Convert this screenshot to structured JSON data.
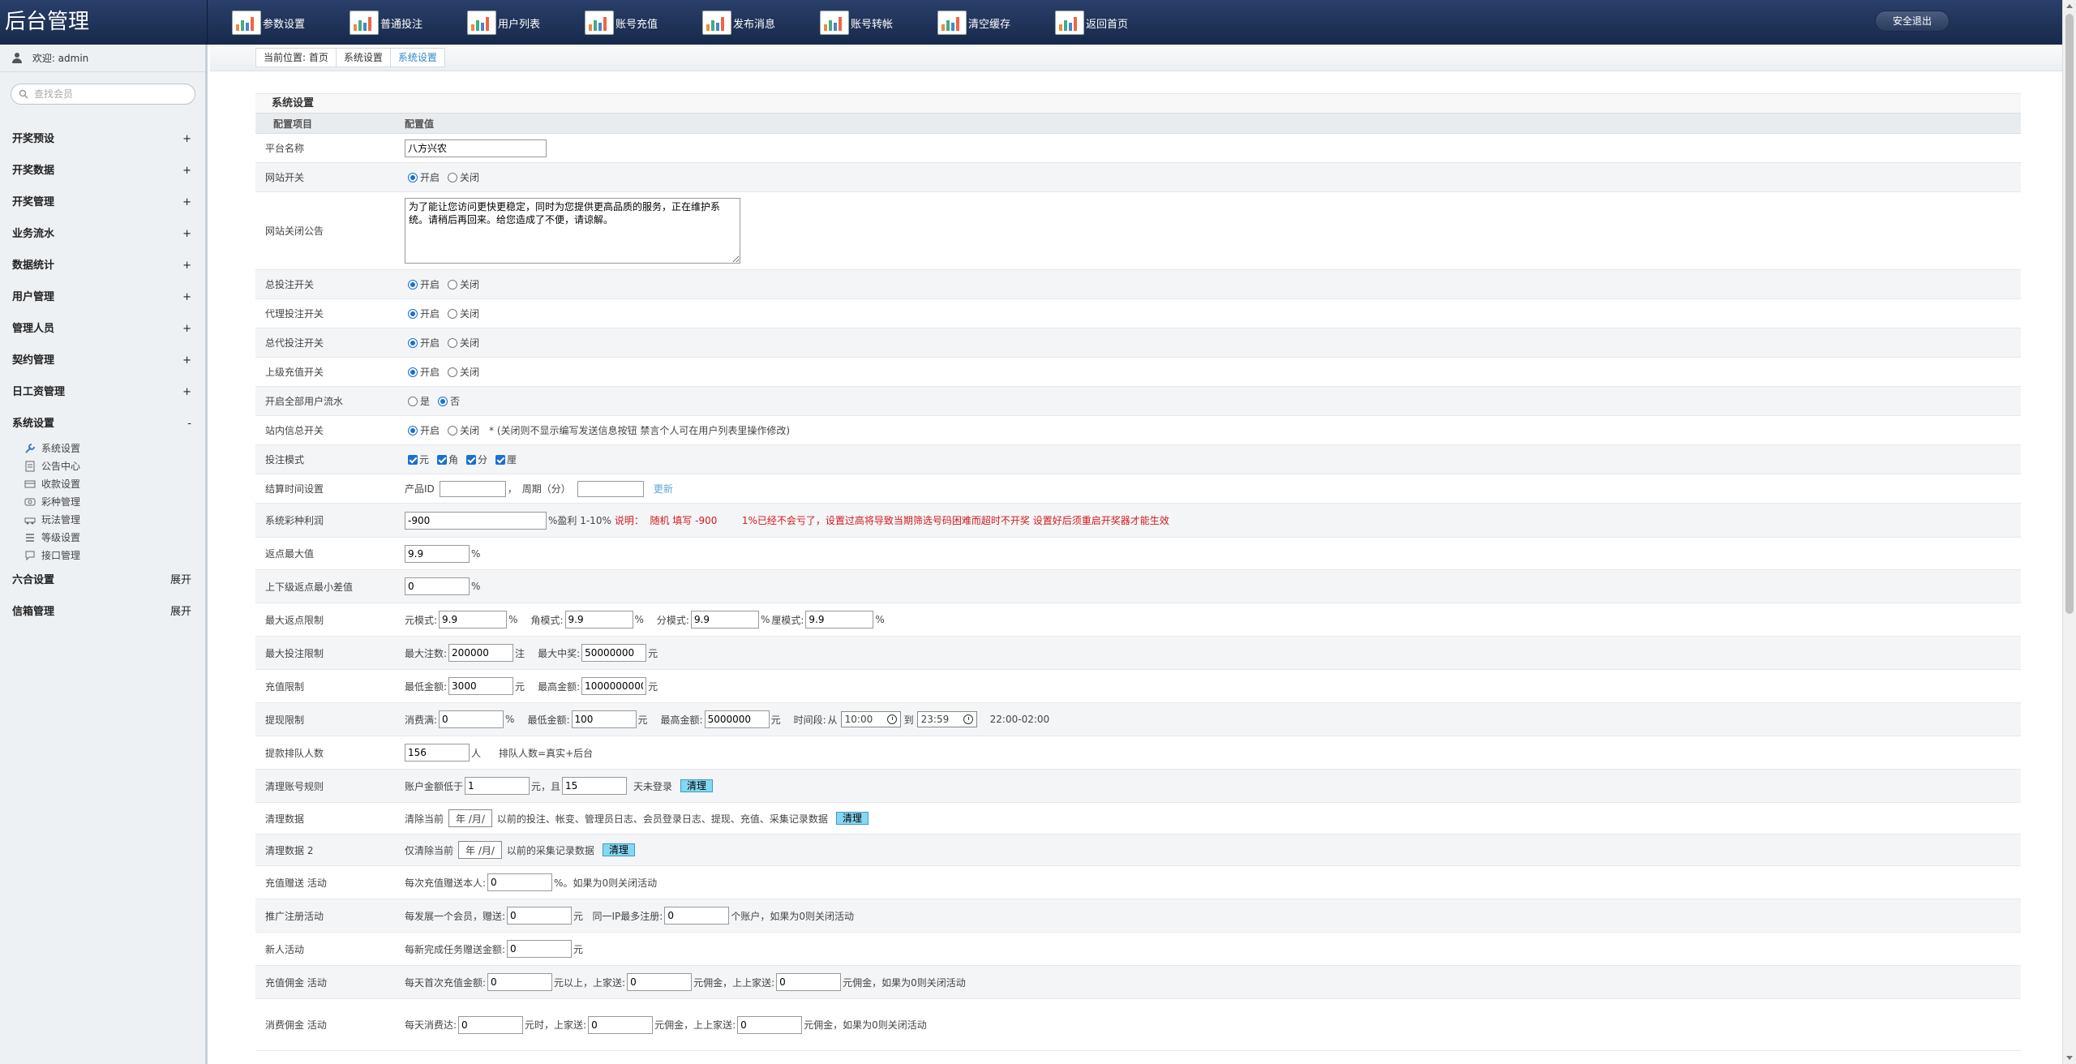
{
  "header": {
    "brand": "后台管理",
    "nav": [
      "参数设置",
      "普通投注",
      "用户列表",
      "账号充值",
      "发布消息",
      "账号转帐",
      "清空缓存",
      "返回首页"
    ],
    "logout": "安全退出"
  },
  "sidebar": {
    "welcome": "欢迎: admin",
    "search_placeholder": "查找会员",
    "menus": [
      {
        "label": "开奖预设",
        "toggle": "+"
      },
      {
        "label": "开奖数据",
        "toggle": "+"
      },
      {
        "label": "开奖管理",
        "toggle": "+"
      },
      {
        "label": "业务流水",
        "toggle": "+"
      },
      {
        "label": "数据统计",
        "toggle": "+"
      },
      {
        "label": "用户管理",
        "toggle": "+"
      },
      {
        "label": "管理人员",
        "toggle": "+"
      },
      {
        "label": "契约管理",
        "toggle": "+"
      },
      {
        "label": "日工资管理",
        "toggle": "+"
      },
      {
        "label": "系统设置",
        "toggle": "-"
      }
    ],
    "submenus": [
      {
        "label": "系统设置",
        "icon": "wrench-icon"
      },
      {
        "label": "公告中心",
        "icon": "document-icon"
      },
      {
        "label": "收款设置",
        "icon": "bank-card-icon"
      },
      {
        "label": "彩种管理",
        "icon": "ticket-icon"
      },
      {
        "label": "玩法管理",
        "icon": "car-icon"
      },
      {
        "label": "等级设置",
        "icon": "list-icon"
      },
      {
        "label": "接口管理",
        "icon": "chat-icon"
      }
    ],
    "bottom_menus": [
      {
        "label": "六合设置",
        "toggle": "展开"
      },
      {
        "label": "信箱管理",
        "toggle": "展开"
      }
    ]
  },
  "breadcrumb": [
    "当前位置: 首页",
    "系统设置",
    "系统设置"
  ],
  "panel": {
    "title": "系统设置",
    "col_key": "配置项目",
    "col_val": "配置值"
  },
  "rows": {
    "platform_name": {
      "label": "平台名称",
      "value": "八方兴农"
    },
    "site_switch": {
      "label": "网站开关",
      "on": "开启",
      "off": "关闭"
    },
    "close_notice": {
      "label": "网站关闭公告",
      "value": "为了能让您访问更快更稳定，同时为您提供更高品质的服务，正在维护系统。请稍后再回来。给您造成了不便，请谅解。"
    },
    "bet_switch": {
      "label": "总投注开关",
      "on": "开启",
      "off": "关闭"
    },
    "agent_bet": {
      "label": "代理投注开关",
      "on": "开启",
      "off": "关闭"
    },
    "general_agent_bet": {
      "label": "总代投注开关",
      "on": "开启",
      "off": "关闭"
    },
    "upper_recharge": {
      "label": "上级充值开关",
      "on": "开启",
      "off": "关闭"
    },
    "all_user_flow": {
      "label": "开启全部用户流水",
      "yes": "是",
      "no": "否"
    },
    "inbox_switch": {
      "label": "站内信总开关",
      "on": "开启",
      "off": "关闭",
      "note": "* (关闭则不显示编写发送信息按钮 禁言个人可在用户列表里操作修改)"
    },
    "bet_mode": {
      "label": "投注模式",
      "options": [
        "元",
        "角",
        "分",
        "厘"
      ]
    },
    "settle_time": {
      "label": "结算时间设置",
      "pid": "产品ID",
      "period": "周期（分）",
      "update": "更新"
    },
    "lottery_profit": {
      "label": "系统彩种利润",
      "value": "-900",
      "suffix": "%盈利 1-10%",
      "note": "说明：  随机 填写 -900        1%已经不会亏了，设置过高将导致当期筛选号码困难而超时不开奖 设置好后须重启开奖器才能生效"
    },
    "max_rebate": {
      "label": "返点最大值",
      "value": "9.9",
      "unit": "%"
    },
    "rebate_diff": {
      "label": "上下级返点最小差值",
      "value": "0",
      "unit": "%"
    },
    "max_rebate_limit": {
      "label": "最大返点限制",
      "yuan": "元模式:",
      "jiao": "角模式:",
      "fen": "分模式:",
      "li": "厘模式:",
      "v1": "9.9",
      "v2": "9.9",
      "v3": "9.9",
      "v4": "9.9",
      "unit": "%"
    },
    "max_bet_limit": {
      "label": "最大投注限制",
      "max_count": "最大注数:",
      "count": "200000",
      "zhu": "注",
      "max_win": "最大中奖:",
      "win": "50000000",
      "yuan": "元"
    },
    "recharge_limit": {
      "label": "充值限制",
      "min": "最低金额:",
      "min_v": "3000",
      "max": "最高金额:",
      "max_v": "1000000000",
      "yuan": "元"
    },
    "withdraw_limit": {
      "label": "提现限制",
      "consume": "消费满:",
      "consume_v": "0",
      "pct": "%",
      "min": "最低金额:",
      "min_v": "100",
      "yuan1": "元",
      "max": "最高金额:",
      "max_v": "5000000",
      "yuan2": "元",
      "period": "时间段:",
      "from": "从",
      "from_v": "10:00",
      "to": "到",
      "to_v": "23:59",
      "range": "22:00-02:00"
    },
    "queue": {
      "label": "提款排队人数",
      "value": "156",
      "unit": "人",
      "note": "排队人数=真实+后台"
    },
    "clean_account": {
      "label": "清理账号规则",
      "pre": "账户金额低于",
      "v1": "1",
      "mid": "元，且",
      "v2": "15",
      "post": "天未登录",
      "btn": "清理"
    },
    "clean_data": {
      "label": "清理数据",
      "pre": "清除当前",
      "date": "年 /月/",
      "post": "以前的投注、帐变、管理员日志、会员登录日志、提现、充值、采集记录数据",
      "btn": "清理"
    },
    "clean_data2": {
      "label": "清理数据 2",
      "pre": "仅清除当前",
      "date": "年 /月/",
      "post": "以前的采集记录数据",
      "btn": "清理"
    },
    "recharge_gift": {
      "label": "充值赠送 活动",
      "pre": "每次充值赠送本人:",
      "value": "0",
      "post": "%。如果为0则关闭活动"
    },
    "promo_register": {
      "label": "推广注册活动",
      "pre": "每发展一个会员，赠送:",
      "v1": "0",
      "mid": "元   同一IP最多注册:",
      "v2": "0",
      "post": "个账户，如果为0则关闭活动"
    },
    "newbie": {
      "label": "新人活动",
      "pre": "每新完成任务赠送金额:",
      "value": "0",
      "unit": "元"
    },
    "recharge_commission": {
      "label": "充值佣金 活动",
      "pre": "每天首次充值金额:",
      "v1": "0",
      "m1": "元以上，上家送:",
      "v2": "0",
      "m2": "元佣金，上上家送:",
      "v3": "0",
      "post": "元佣金，如果为0则关闭活动"
    },
    "consume_commission": {
      "label": "消费佣金 活动",
      "pre": "每天消费达:",
      "v1": "0",
      "m1": "元时，上家送:",
      "v2": "0",
      "m2": "元佣金，上上家送:",
      "v3": "0",
      "post": "元佣金，如果为0则关闭活动"
    }
  }
}
